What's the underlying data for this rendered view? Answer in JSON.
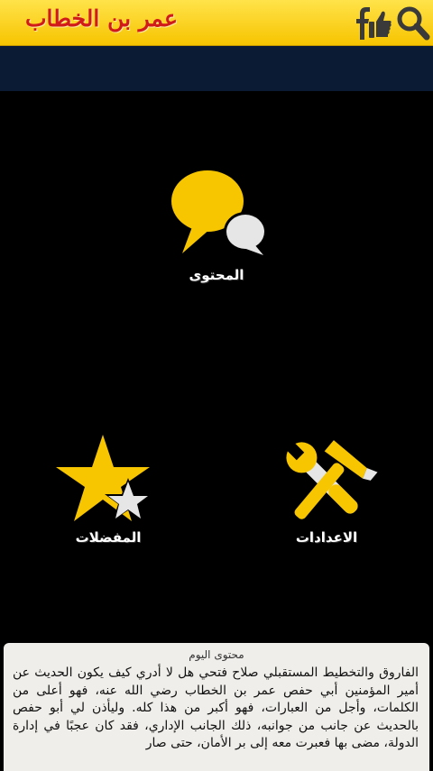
{
  "header": {
    "title": "عمر بن الخطاب",
    "icons": [
      "facebook-icon",
      "like-icon",
      "search-icon"
    ],
    "accent_color": "#f7c400",
    "title_color": "#d11a1a"
  },
  "menu": {
    "content_label": "المحتوى",
    "favorites_label": "المفضلات",
    "settings_label": "الاعدادات"
  },
  "today": {
    "title": "محتوى اليوم",
    "text": "الفاروق والتخطيط المستقبلي صلاح فتحي هل لا أدري كيف يكون الحديث عن أمير المؤمنين أبي حفص عمر بن الخطاب رضي الله عنه، فهو أعلى من الكلمات، وأجل من العبارات، فهو أكبر من هذا كله. وليأذن لي أبو حفص بالحديث عن جانب من جوانبه، ذلك الجانب الإداري، فقد كان عجبًا في إدارة الدولة، مضى بها فعبرت معه إلى بر الأمان، حتى صار"
  }
}
